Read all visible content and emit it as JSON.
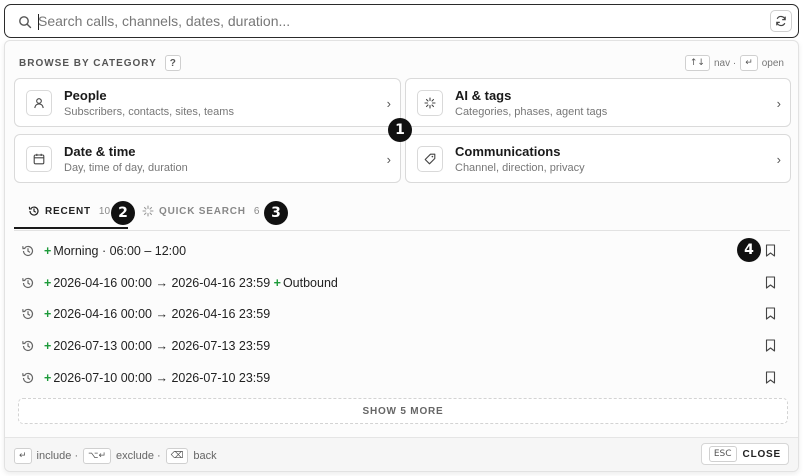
{
  "search": {
    "placeholder": "Search calls, channels, dates, duration..."
  },
  "browse": {
    "title": "BROWSE BY CATEGORY",
    "help": "?",
    "nav_hint": {
      "nav_keys": "↑↓",
      "nav_label": "nav ·",
      "open_key": "↵",
      "open_label": "open"
    }
  },
  "categories": [
    {
      "title": "People",
      "subtitle": "Subscribers, contacts, sites, teams",
      "icon": "person-icon"
    },
    {
      "title": "AI & tags",
      "subtitle": "Categories, phases, agent tags",
      "icon": "sparkle-icon"
    },
    {
      "title": "Date & time",
      "subtitle": "Day, time of day, duration",
      "icon": "calendar-icon"
    },
    {
      "title": "Communications",
      "subtitle": "Channel, direction, privacy",
      "icon": "tag-icon"
    }
  ],
  "tabs": [
    {
      "label": "RECENT",
      "count": "10",
      "active": true
    },
    {
      "label": "QUICK SEARCH",
      "count": "6",
      "active": false
    }
  ],
  "recent": [
    {
      "plus": "+",
      "text": "Morning · 06:00 – 12:00",
      "extra_plus": "",
      "extra": ""
    },
    {
      "plus": "+",
      "text": "2026-04-16 00:00 → 2026-04-16 23:59",
      "extra_plus": "+",
      "extra": "Outbound"
    },
    {
      "plus": "+",
      "text": "2026-04-16 00:00 → 2026-04-16 23:59",
      "extra_plus": "",
      "extra": ""
    },
    {
      "plus": "+",
      "text": "2026-07-13 00:00 → 2026-07-13 23:59",
      "extra_plus": "",
      "extra": ""
    },
    {
      "plus": "+",
      "text": "2026-07-10 00:00 → 2026-07-10 23:59",
      "extra_plus": "",
      "extra": ""
    }
  ],
  "show_more": "SHOW 5 MORE",
  "footer": {
    "include_key": "↵",
    "include_label": "include ·",
    "exclude_key": "⌥↵",
    "exclude_label": "exclude ·",
    "back_key": "⌫",
    "back_label": "back",
    "esc_key": "ESC",
    "close_label": "CLOSE"
  },
  "markers": [
    "1",
    "2",
    "3",
    "4"
  ],
  "colors": {
    "accent_green": "#1d9a3a",
    "text_dark": "#1f1f1f",
    "muted": "#777777"
  }
}
